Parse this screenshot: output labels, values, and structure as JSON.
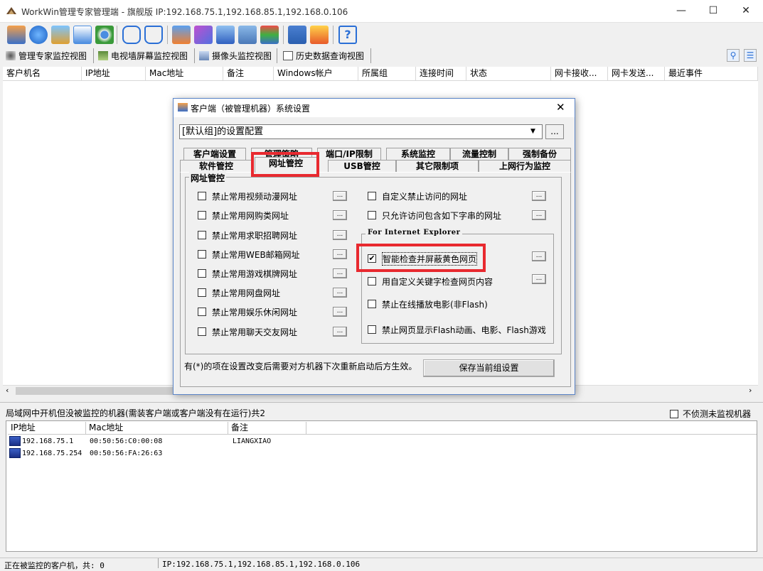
{
  "window": {
    "title": "WorkWin管理专家管理端 - 旗舰版 IP:192.168.75.1,192.168.85.1,192.168.0.106",
    "min": "—",
    "max": "☐",
    "close": "✕"
  },
  "view_tabs": [
    {
      "label": "管理专家监控视图",
      "icon": "monitor-view-icon"
    },
    {
      "label": "电视墙屏幕监控视图",
      "icon": "tv-wall-icon"
    },
    {
      "label": "摄像头监控视图",
      "icon": "camera-icon"
    },
    {
      "label": "历史数据查询视图",
      "icon": "history-icon"
    }
  ],
  "client_table": {
    "headers": [
      "客户机名",
      "IP地址",
      "Mac地址",
      "备注",
      "Windows帐户",
      "所属组",
      "连接时间",
      "状态",
      "网卡接收...",
      "网卡发送...",
      "最近事件"
    ]
  },
  "lower_panel": {
    "title": "局域网中开机但没被监控的机器(需装客户端或客户端没有在运行)共2",
    "checkbox_label": "不侦测未监视机器",
    "headers": [
      "IP地址",
      "Mac地址",
      "备注"
    ],
    "rows": [
      {
        "ip": "192.168.75.1",
        "mac": "00:50:56:C0:00:08",
        "note": "LIANGXIAO"
      },
      {
        "ip": "192.168.75.254",
        "mac": "00:50:56:FA:26:63",
        "note": ""
      }
    ]
  },
  "status": {
    "left": "正在被监控的客户机，共: 0",
    "right": "IP:192.168.75.1,192.168.85.1,192.168.0.106"
  },
  "dialog": {
    "title": "客户端（被管理机器）系统设置",
    "close": "✕",
    "group_select": "[默认组]的设置配置",
    "select_btn": "...",
    "tabs_row1": [
      "客户端设置",
      "管理策略",
      "端口/IP限制",
      "系统监控",
      "流量控制",
      "强制备份"
    ],
    "tabs_row2": [
      "软件管控",
      "网址管控",
      "USB管控",
      "其它限制项",
      "上网行为监控"
    ],
    "active_tab": "网址管控",
    "group_title": "网址管控",
    "left_options": [
      "禁止常用视频动漫网址",
      "禁止常用网购类网址",
      "禁止常用求职招聘网址",
      "禁止常用WEB邮箱网址",
      "禁止常用游戏棋牌网址",
      "禁止常用网盘网址",
      "禁止常用娱乐休闲网址",
      "禁止常用聊天交友网址"
    ],
    "right_options": [
      "自定义禁止访问的网址",
      "只允许访问包含如下字串的网址"
    ],
    "ie_group_title": "For Internet Explorer",
    "ie_options": [
      {
        "label": "智能检查并屏蔽黄色网页",
        "checked": true
      },
      {
        "label": "用自定义关键字检查网页内容",
        "checked": false
      },
      {
        "label": "禁止在线播放电影(非Flash)",
        "checked": false
      },
      {
        "label": "禁止网页显示Flash动画、电影、Flash游戏",
        "checked": false
      }
    ],
    "dot_btn": "...",
    "footer_note": "有(*)的项在设置改变后需要对方机器下次重新启动后方生效。",
    "save_btn": "保存当前组设置",
    "checkmark": "✔"
  },
  "colors": {
    "highlight": "#e8292f"
  }
}
